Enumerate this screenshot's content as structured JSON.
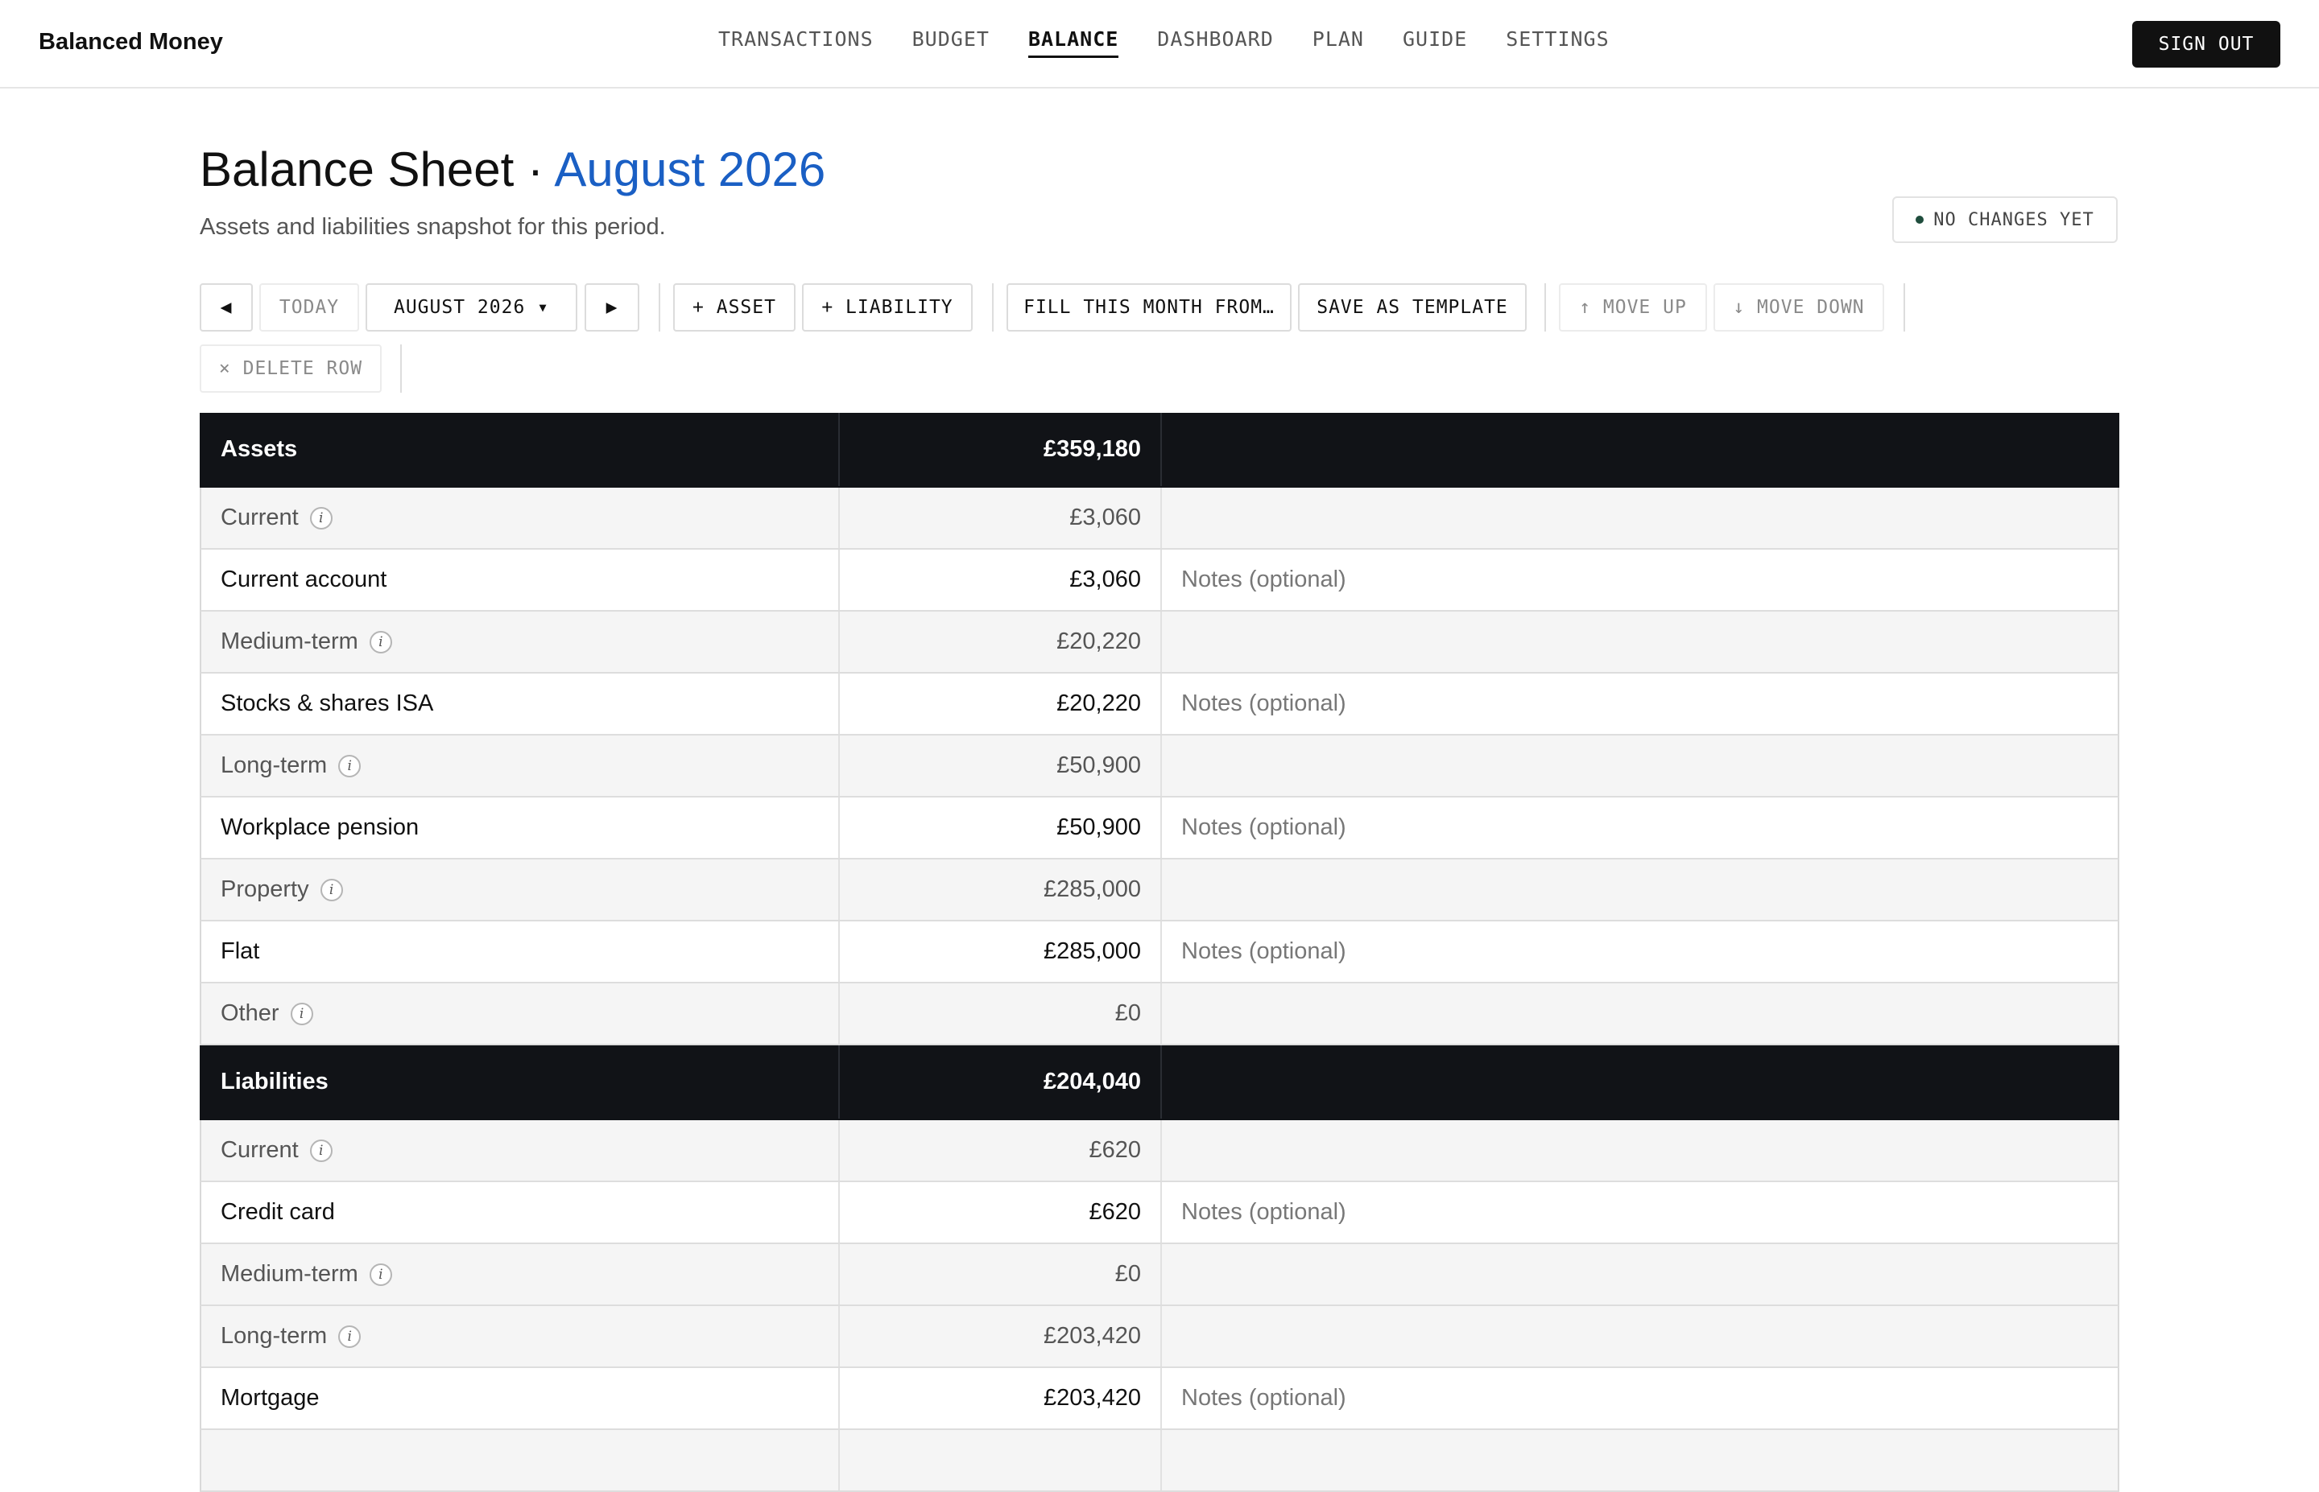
{
  "app": {
    "brand": "Balanced Money",
    "nav": [
      "TRANSACTIONS",
      "BUDGET",
      "BALANCE",
      "DASHBOARD",
      "PLAN",
      "GUIDE",
      "SETTINGS"
    ],
    "active_nav": "BALANCE",
    "sign_out": "SIGN OUT"
  },
  "header": {
    "title": "Balance Sheet ·",
    "period": "August 2026",
    "subtitle": "Assets and liabilities snapshot for this period.",
    "status": "NO CHANGES YET"
  },
  "toolbar": {
    "prev": "◀",
    "today": "TODAY",
    "month": "AUGUST 2026 ▾",
    "next": "▶",
    "add_asset": "+ ASSET",
    "add_liability": "+ LIABILITY",
    "fill_month": "FILL THIS MONTH FROM…",
    "save_template": "SAVE AS TEMPLATE",
    "move_up": "↑ MOVE UP",
    "move_down": "↓ MOVE DOWN",
    "delete_row": "× DELETE ROW"
  },
  "sheet": {
    "assets": {
      "label": "Assets",
      "total": "£359,180",
      "groups": {
        "current": {
          "label": "Current",
          "total": "£3,060"
        },
        "medium": {
          "label": "Medium-term",
          "total": "£20,220"
        },
        "long": {
          "label": "Long-term",
          "total": "£50,900"
        },
        "property": {
          "label": "Property",
          "total": "£285,000"
        },
        "other": {
          "label": "Other",
          "total": "£0"
        }
      },
      "items": {
        "current_account": {
          "name": "Current account",
          "amount": "£3,060",
          "note": "Notes (optional)"
        },
        "isa": {
          "name": "Stocks & shares ISA",
          "amount": "£20,220",
          "note": "Notes (optional)"
        },
        "pension": {
          "name": "Workplace pension",
          "amount": "£50,900",
          "note": "Notes (optional)"
        },
        "flat": {
          "name": "Flat",
          "amount": "£285,000",
          "note": "Notes (optional)"
        }
      }
    },
    "liabilities": {
      "label": "Liabilities",
      "total": "£204,040",
      "groups": {
        "current": {
          "label": "Current",
          "total": "£620"
        },
        "medium": {
          "label": "Medium-term",
          "total": "£0"
        },
        "long": {
          "label": "Long-term",
          "total": "£203,420"
        }
      },
      "items": {
        "credit_card": {
          "name": "Credit card",
          "amount": "£620",
          "note": "Notes (optional)"
        },
        "mortgage": {
          "name": "Mortgage",
          "amount": "£203,420",
          "note": "Notes (optional)"
        }
      }
    },
    "info_glyph": "i"
  }
}
